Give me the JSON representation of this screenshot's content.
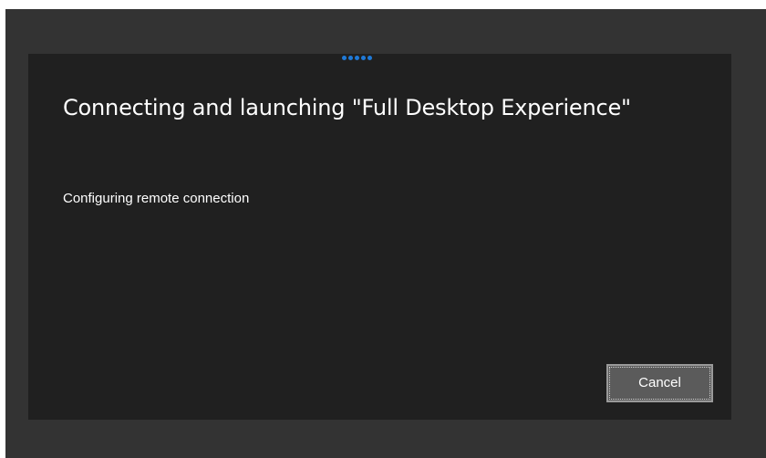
{
  "dialog": {
    "title": "Connecting and launching \"Full Desktop Experience\"",
    "status_message": "Configuring remote connection",
    "progress_indicator": {
      "type": "indeterminate-dots",
      "dot_count": 5,
      "color": "#1f7ad8"
    },
    "cancel_label": "Cancel"
  },
  "colors": {
    "window_background": "#333333",
    "dialog_background": "#202020",
    "text": "#ffffff",
    "button_background": "#5b5b5b",
    "button_border": "#9a9a9a"
  }
}
